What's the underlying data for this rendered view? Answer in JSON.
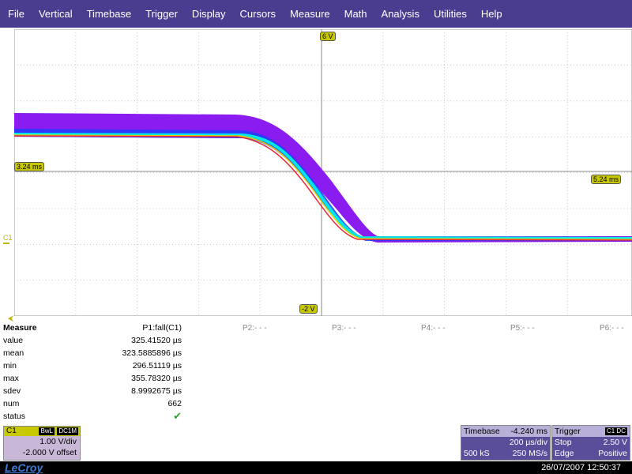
{
  "menu": [
    "File",
    "Vertical",
    "Timebase",
    "Trigger",
    "Display",
    "Cursors",
    "Measure",
    "Math",
    "Analysis",
    "Utilities",
    "Help"
  ],
  "markers": {
    "top_volt": "6 V",
    "bottom_volt": "-2 V",
    "left_time": "3.24 ms",
    "right_time": "5.24 ms"
  },
  "channel_label": "C1",
  "measure": {
    "title": "Measure",
    "p1_header": "P1:fall(C1)",
    "other_params": [
      "P2:- - -",
      "P3:- - -",
      "P4:- - -",
      "P5:- - -",
      "P6:- - -"
    ],
    "rows": [
      {
        "label": "value",
        "value": "325.41520 µs"
      },
      {
        "label": "mean",
        "value": "323.5885896 µs"
      },
      {
        "label": "min",
        "value": "296.51119 µs"
      },
      {
        "label": "max",
        "value": "355.78320 µs"
      },
      {
        "label": "sdev",
        "value": "8.9992675 µs"
      },
      {
        "label": "num",
        "value": "662"
      },
      {
        "label": "status",
        "value": "✔"
      }
    ]
  },
  "c1_panel": {
    "label": "C1",
    "badge1": "BwL",
    "badge2": "DC1M",
    "scale": "1.00 V/div",
    "offset": "-2.000 V offset"
  },
  "timebase": {
    "label": "Timebase",
    "delay": "-4.240 ms",
    "per_div": "200 µs/div",
    "samples": "500 kS",
    "rate": "250 MS/s"
  },
  "trigger": {
    "label": "Trigger",
    "badge": "C1 DC",
    "mode": "Stop",
    "level": "2.50 V",
    "type": "Edge",
    "slope": "Positive"
  },
  "brand": "LeCroy",
  "datetime": "26/07/2007 12:50:37",
  "colors": {
    "menubar": "#4a3d8f",
    "trace_envelope": "#8a1cf0",
    "trace_core_blue": "#1e3cff",
    "trace_cyan": "#00e5e5",
    "trace_yellow": "#e8d400",
    "trace_red": "#e8283c",
    "marker_yellow": "#c8c800"
  }
}
